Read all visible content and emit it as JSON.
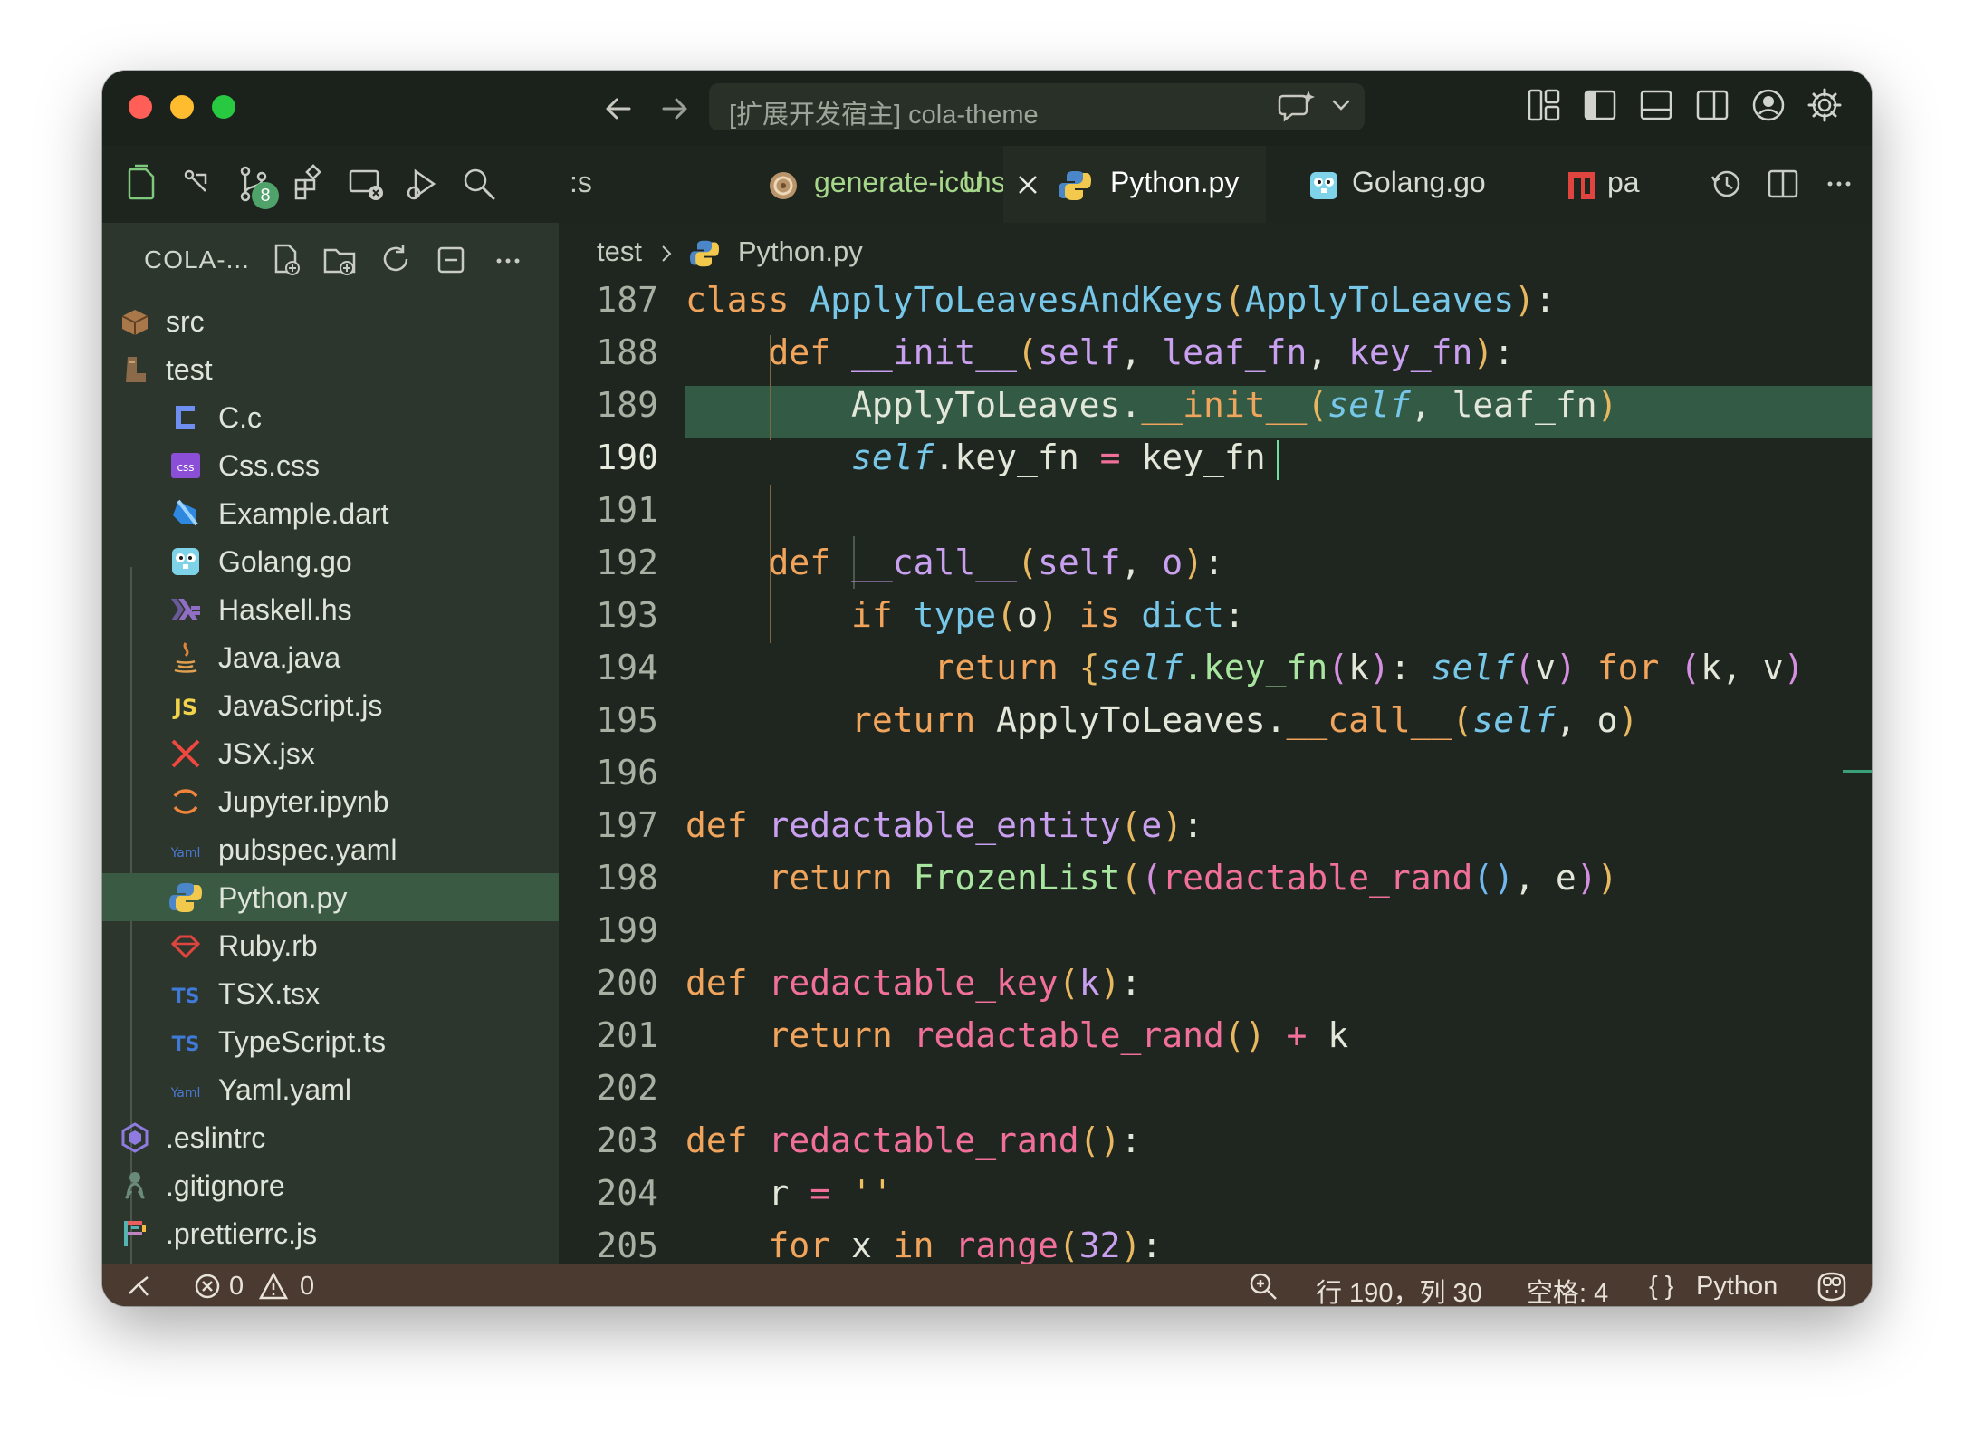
{
  "titlebar": {
    "command_center_text": "[扩展开发宿主] cola-theme"
  },
  "activity_icons": [
    "explorer-icon",
    "source-control-branch-icon",
    "source-control-icon",
    "extensions-icon",
    "remote-explorer-icon",
    "run-debug-icon",
    "search-icon"
  ],
  "source_control_badge": "8",
  "tabs": [
    {
      "label": ":s",
      "color": "#c4cbbf"
    },
    {
      "label": "generate-icons.sh",
      "modified": "U",
      "color": "#a6d68a"
    },
    {
      "label": "Python.py",
      "color": "#ffffff",
      "active": true
    },
    {
      "label": "Golang.go",
      "color": "#d7dcd2"
    },
    {
      "label": "pa",
      "color": "#d7dcd2"
    }
  ],
  "sidebar": {
    "title": "COLA-...",
    "items": [
      {
        "label": "src",
        "icon": "folder-box-icon"
      },
      {
        "label": "test",
        "icon": "folder-boot-icon"
      },
      {
        "label": "C.c",
        "icon": "c-icon"
      },
      {
        "label": "Css.css",
        "icon": "css-icon",
        "badge": "css"
      },
      {
        "label": "Example.dart",
        "icon": "dart-icon"
      },
      {
        "label": "Golang.go",
        "icon": "gopher-icon"
      },
      {
        "label": "Haskell.hs",
        "icon": "haskell-icon"
      },
      {
        "label": "Java.java",
        "icon": "java-icon"
      },
      {
        "label": "JavaScript.js",
        "icon": "javascript-icon",
        "badge": "JS"
      },
      {
        "label": "JSX.jsx",
        "icon": "jsx-icon"
      },
      {
        "label": "Jupyter.ipynb",
        "icon": "jupyter-icon"
      },
      {
        "label": "pubspec.yaml",
        "icon": "yaml-icon",
        "badge": "Yaml"
      },
      {
        "label": "Python.py",
        "icon": "python-icon",
        "selected": true
      },
      {
        "label": "Ruby.rb",
        "icon": "ruby-icon"
      },
      {
        "label": "TSX.tsx",
        "icon": "typescript-icon",
        "badge": "TS"
      },
      {
        "label": "TypeScript.ts",
        "icon": "typescript-icon",
        "badge": "TS"
      },
      {
        "label": "Yaml.yaml",
        "icon": "yaml-icon",
        "badge": "Yaml"
      },
      {
        "label": ".eslintrc",
        "icon": "eslint-icon"
      },
      {
        "label": ".gitignore",
        "icon": "git-icon"
      },
      {
        "label": ".prettierrc.js",
        "icon": "prettier-icon"
      }
    ]
  },
  "breadcrumb": {
    "folder": "test",
    "file": "Python.py"
  },
  "code": {
    "current_line": 190,
    "lines": [
      {
        "n": "187",
        "tokens": [
          [
            "class ",
            "k-orange"
          ],
          [
            "ApplyToLeavesAndKeys",
            "k-blue"
          ],
          [
            "(",
            "br1"
          ],
          [
            "ApplyToLeaves",
            "k-blue"
          ],
          [
            ")",
            "br1"
          ],
          [
            ":",
            "punct"
          ]
        ]
      },
      {
        "n": "188",
        "tokens": [
          [
            "    def ",
            "k-orange"
          ],
          [
            "__init__",
            "k-purple"
          ],
          [
            "(",
            "br1"
          ],
          [
            "self",
            "k-purple"
          ],
          [
            ", ",
            "punct"
          ],
          [
            "leaf_fn",
            "k-purple"
          ],
          [
            ", ",
            "punct"
          ],
          [
            "key_fn",
            "k-purple"
          ],
          [
            ")",
            "br1"
          ],
          [
            ":",
            "punct"
          ]
        ]
      },
      {
        "n": "189",
        "tokens": [
          [
            "        ApplyToLeaves.",
            "punct"
          ],
          [
            "__init__",
            "k-orange"
          ],
          [
            "(",
            "br1"
          ],
          [
            "self",
            "k-italic"
          ],
          [
            ", leaf_fn",
            "punct"
          ],
          [
            ")",
            "br1"
          ]
        ]
      },
      {
        "n": "190",
        "tokens": [
          [
            "        ",
            "punct"
          ],
          [
            "self",
            "k-italic"
          ],
          [
            ".key_fn ",
            "punct"
          ],
          [
            "=",
            "k-pink"
          ],
          [
            " key_fn",
            "punct"
          ]
        ]
      },
      {
        "n": "191",
        "tokens": []
      },
      {
        "n": "192",
        "tokens": [
          [
            "    def ",
            "k-orange"
          ],
          [
            "__call__",
            "k-purple"
          ],
          [
            "(",
            "br1"
          ],
          [
            "self",
            "k-purple"
          ],
          [
            ", ",
            "punct"
          ],
          [
            "o",
            "k-purple"
          ],
          [
            ")",
            "br1"
          ],
          [
            ":",
            "punct"
          ]
        ]
      },
      {
        "n": "193",
        "tokens": [
          [
            "        if ",
            "k-orange"
          ],
          [
            "type",
            "k-blue"
          ],
          [
            "(",
            "br1"
          ],
          [
            "o",
            "punct"
          ],
          [
            ")",
            "br1"
          ],
          [
            " is ",
            "k-orange"
          ],
          [
            "dict",
            "k-blue"
          ],
          [
            ":",
            "punct"
          ]
        ]
      },
      {
        "n": "194",
        "tokens": [
          [
            "            return ",
            "k-orange"
          ],
          [
            "{",
            "br1"
          ],
          [
            "self",
            "k-italic"
          ],
          [
            ".key_fn",
            "k-green"
          ],
          [
            "(",
            "br2"
          ],
          [
            "k",
            "punct"
          ],
          [
            ")",
            "br2"
          ],
          [
            ": ",
            "punct"
          ],
          [
            "self",
            "k-italic"
          ],
          [
            "(",
            "br2"
          ],
          [
            "v",
            "punct"
          ],
          [
            ")",
            "br2"
          ],
          [
            " for ",
            "k-orange"
          ],
          [
            "(",
            "br2"
          ],
          [
            "k, v",
            "punct"
          ],
          [
            ")",
            "br2"
          ]
        ]
      },
      {
        "n": "195",
        "tokens": [
          [
            "        return ",
            "k-orange"
          ],
          [
            "ApplyToLeaves.",
            "punct"
          ],
          [
            "__call__",
            "k-orange"
          ],
          [
            "(",
            "br1"
          ],
          [
            "self",
            "k-italic"
          ],
          [
            ", o",
            "punct"
          ],
          [
            ")",
            "br1"
          ]
        ]
      },
      {
        "n": "196",
        "tokens": []
      },
      {
        "n": "197",
        "tokens": [
          [
            "def ",
            "k-orange"
          ],
          [
            "redactable_entity",
            "k-purple"
          ],
          [
            "(",
            "br1"
          ],
          [
            "e",
            "k-purple"
          ],
          [
            ")",
            "br1"
          ],
          [
            ":",
            "punct"
          ]
        ]
      },
      {
        "n": "198",
        "tokens": [
          [
            "    return ",
            "k-orange"
          ],
          [
            "FrozenList",
            "k-green"
          ],
          [
            "(",
            "br1"
          ],
          [
            "(",
            "br2"
          ],
          [
            "redactable_rand",
            "k-pink"
          ],
          [
            "()",
            "br3"
          ],
          [
            ", e",
            "punct"
          ],
          [
            ")",
            "br2"
          ],
          [
            ")",
            "br1"
          ]
        ]
      },
      {
        "n": "199",
        "tokens": []
      },
      {
        "n": "200",
        "tokens": [
          [
            "def ",
            "k-orange"
          ],
          [
            "redactable_key",
            "k-pink"
          ],
          [
            "(",
            "br1"
          ],
          [
            "k",
            "k-purple"
          ],
          [
            ")",
            "br1"
          ],
          [
            ":",
            "punct"
          ]
        ]
      },
      {
        "n": "201",
        "tokens": [
          [
            "    return ",
            "k-orange"
          ],
          [
            "redactable_rand",
            "k-pink"
          ],
          [
            "()",
            "br1"
          ],
          [
            " + ",
            "k-pink"
          ],
          [
            "k",
            "punct"
          ]
        ]
      },
      {
        "n": "202",
        "tokens": []
      },
      {
        "n": "203",
        "tokens": [
          [
            "def ",
            "k-orange"
          ],
          [
            "redactable_rand",
            "k-pink"
          ],
          [
            "()",
            "br1"
          ],
          [
            ":",
            "punct"
          ]
        ]
      },
      {
        "n": "204",
        "tokens": [
          [
            "    r ",
            "punct"
          ],
          [
            "=",
            "k-pink"
          ],
          [
            " ",
            "punct"
          ],
          [
            "''",
            "str"
          ]
        ]
      },
      {
        "n": "205",
        "tokens": [
          [
            "    for ",
            "k-orange"
          ],
          [
            "x ",
            "punct"
          ],
          [
            "in ",
            "k-orange"
          ],
          [
            "range",
            "k-pink"
          ],
          [
            "(",
            "br1"
          ],
          [
            "32",
            "num"
          ],
          [
            ")",
            "br1"
          ],
          [
            ":",
            "punct"
          ]
        ]
      }
    ]
  },
  "status": {
    "errors": "0",
    "warnings": "0",
    "position": "行 190，列 30",
    "spaces": "空格: 4",
    "language_braces": "{ }",
    "language": "Python"
  }
}
